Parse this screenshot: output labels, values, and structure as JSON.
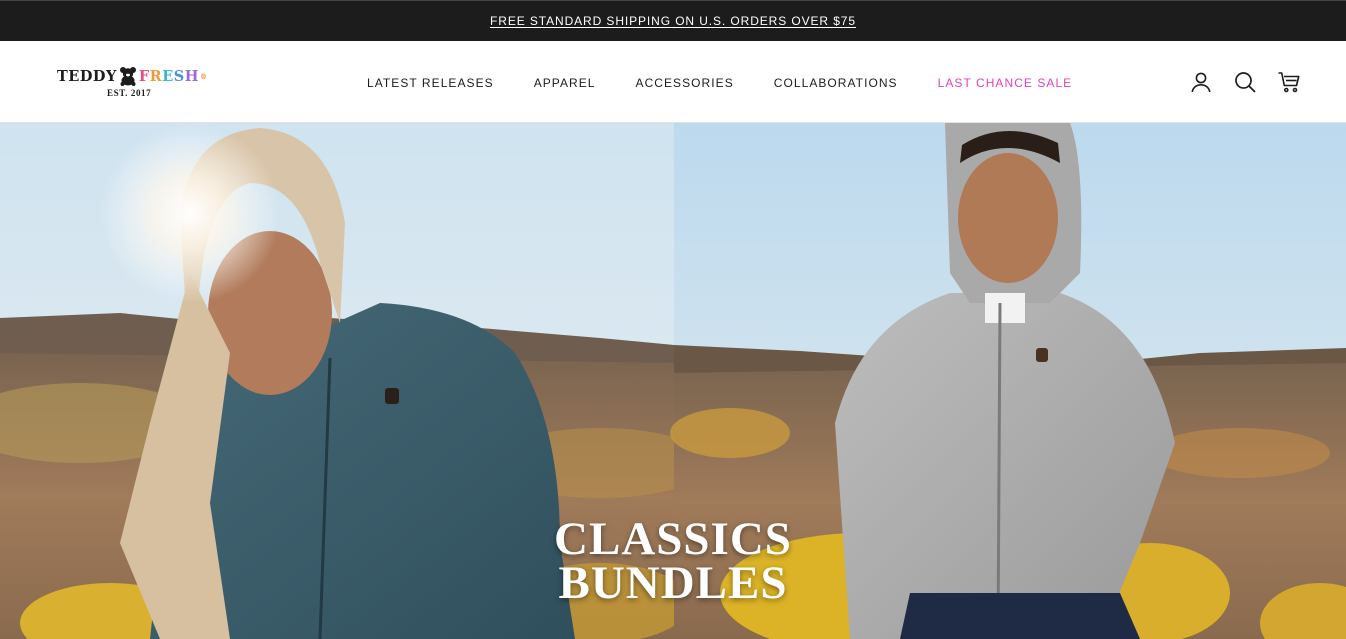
{
  "announcement": {
    "text": "FREE STANDARD SHIPPING ON U.S. ORDERS OVER $75"
  },
  "logo": {
    "word1": "TEDDY",
    "word2_letters": [
      "F",
      "R",
      "E",
      "S",
      "H"
    ],
    "word2_colors": [
      "#e84a8a",
      "#f29a3a",
      "#3bb7c9",
      "#4a8fe0",
      "#9a6bd6"
    ],
    "registered": "®",
    "established": "EST. 2017"
  },
  "nav": {
    "items": [
      {
        "label": "LATEST RELEASES"
      },
      {
        "label": "APPAREL"
      },
      {
        "label": "ACCESSORIES"
      },
      {
        "label": "COLLABORATIONS"
      },
      {
        "label": "LAST CHANCE SALE",
        "color": "#e33fbd"
      }
    ]
  },
  "header_icons": [
    "account-icon",
    "search-icon",
    "cart-icon"
  ],
  "hero": {
    "title_line1": "CLASSICS",
    "title_line2": "BUNDLES"
  },
  "colors": {
    "announcement_bg": "#1c1c1c",
    "text": "#1c1c1c",
    "sale": "#e33fbd"
  }
}
